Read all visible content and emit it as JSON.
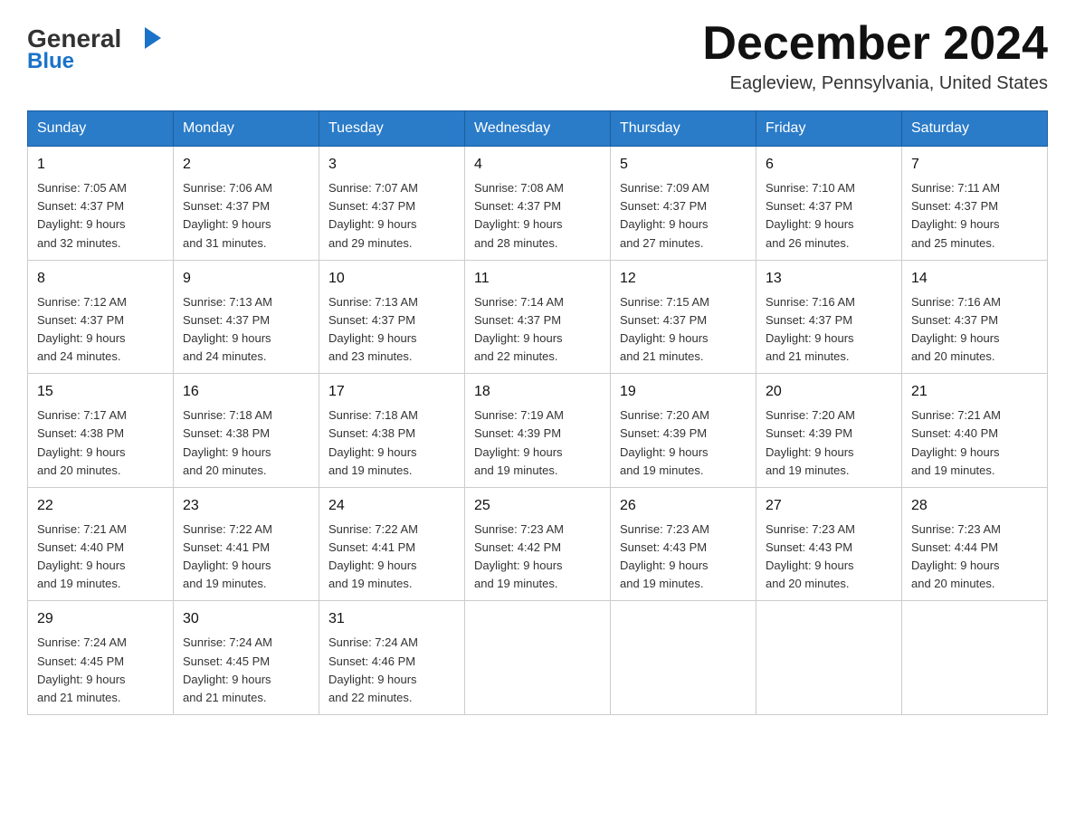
{
  "header": {
    "logo_general": "General",
    "logo_blue": "Blue",
    "month_title": "December 2024",
    "location": "Eagleview, Pennsylvania, United States"
  },
  "weekdays": [
    "Sunday",
    "Monday",
    "Tuesday",
    "Wednesday",
    "Thursday",
    "Friday",
    "Saturday"
  ],
  "weeks": [
    [
      {
        "day": "1",
        "sunrise": "7:05 AM",
        "sunset": "4:37 PM",
        "daylight": "9 hours and 32 minutes."
      },
      {
        "day": "2",
        "sunrise": "7:06 AM",
        "sunset": "4:37 PM",
        "daylight": "9 hours and 31 minutes."
      },
      {
        "day": "3",
        "sunrise": "7:07 AM",
        "sunset": "4:37 PM",
        "daylight": "9 hours and 29 minutes."
      },
      {
        "day": "4",
        "sunrise": "7:08 AM",
        "sunset": "4:37 PM",
        "daylight": "9 hours and 28 minutes."
      },
      {
        "day": "5",
        "sunrise": "7:09 AM",
        "sunset": "4:37 PM",
        "daylight": "9 hours and 27 minutes."
      },
      {
        "day": "6",
        "sunrise": "7:10 AM",
        "sunset": "4:37 PM",
        "daylight": "9 hours and 26 minutes."
      },
      {
        "day": "7",
        "sunrise": "7:11 AM",
        "sunset": "4:37 PM",
        "daylight": "9 hours and 25 minutes."
      }
    ],
    [
      {
        "day": "8",
        "sunrise": "7:12 AM",
        "sunset": "4:37 PM",
        "daylight": "9 hours and 24 minutes."
      },
      {
        "day": "9",
        "sunrise": "7:13 AM",
        "sunset": "4:37 PM",
        "daylight": "9 hours and 24 minutes."
      },
      {
        "day": "10",
        "sunrise": "7:13 AM",
        "sunset": "4:37 PM",
        "daylight": "9 hours and 23 minutes."
      },
      {
        "day": "11",
        "sunrise": "7:14 AM",
        "sunset": "4:37 PM",
        "daylight": "9 hours and 22 minutes."
      },
      {
        "day": "12",
        "sunrise": "7:15 AM",
        "sunset": "4:37 PM",
        "daylight": "9 hours and 21 minutes."
      },
      {
        "day": "13",
        "sunrise": "7:16 AM",
        "sunset": "4:37 PM",
        "daylight": "9 hours and 21 minutes."
      },
      {
        "day": "14",
        "sunrise": "7:16 AM",
        "sunset": "4:37 PM",
        "daylight": "9 hours and 20 minutes."
      }
    ],
    [
      {
        "day": "15",
        "sunrise": "7:17 AM",
        "sunset": "4:38 PM",
        "daylight": "9 hours and 20 minutes."
      },
      {
        "day": "16",
        "sunrise": "7:18 AM",
        "sunset": "4:38 PM",
        "daylight": "9 hours and 20 minutes."
      },
      {
        "day": "17",
        "sunrise": "7:18 AM",
        "sunset": "4:38 PM",
        "daylight": "9 hours and 19 minutes."
      },
      {
        "day": "18",
        "sunrise": "7:19 AM",
        "sunset": "4:39 PM",
        "daylight": "9 hours and 19 minutes."
      },
      {
        "day": "19",
        "sunrise": "7:20 AM",
        "sunset": "4:39 PM",
        "daylight": "9 hours and 19 minutes."
      },
      {
        "day": "20",
        "sunrise": "7:20 AM",
        "sunset": "4:39 PM",
        "daylight": "9 hours and 19 minutes."
      },
      {
        "day": "21",
        "sunrise": "7:21 AM",
        "sunset": "4:40 PM",
        "daylight": "9 hours and 19 minutes."
      }
    ],
    [
      {
        "day": "22",
        "sunrise": "7:21 AM",
        "sunset": "4:40 PM",
        "daylight": "9 hours and 19 minutes."
      },
      {
        "day": "23",
        "sunrise": "7:22 AM",
        "sunset": "4:41 PM",
        "daylight": "9 hours and 19 minutes."
      },
      {
        "day": "24",
        "sunrise": "7:22 AM",
        "sunset": "4:41 PM",
        "daylight": "9 hours and 19 minutes."
      },
      {
        "day": "25",
        "sunrise": "7:23 AM",
        "sunset": "4:42 PM",
        "daylight": "9 hours and 19 minutes."
      },
      {
        "day": "26",
        "sunrise": "7:23 AM",
        "sunset": "4:43 PM",
        "daylight": "9 hours and 19 minutes."
      },
      {
        "day": "27",
        "sunrise": "7:23 AM",
        "sunset": "4:43 PM",
        "daylight": "9 hours and 20 minutes."
      },
      {
        "day": "28",
        "sunrise": "7:23 AM",
        "sunset": "4:44 PM",
        "daylight": "9 hours and 20 minutes."
      }
    ],
    [
      {
        "day": "29",
        "sunrise": "7:24 AM",
        "sunset": "4:45 PM",
        "daylight": "9 hours and 21 minutes."
      },
      {
        "day": "30",
        "sunrise": "7:24 AM",
        "sunset": "4:45 PM",
        "daylight": "9 hours and 21 minutes."
      },
      {
        "day": "31",
        "sunrise": "7:24 AM",
        "sunset": "4:46 PM",
        "daylight": "9 hours and 22 minutes."
      },
      null,
      null,
      null,
      null
    ]
  ],
  "labels": {
    "sunrise": "Sunrise:",
    "sunset": "Sunset:",
    "daylight": "Daylight:"
  }
}
